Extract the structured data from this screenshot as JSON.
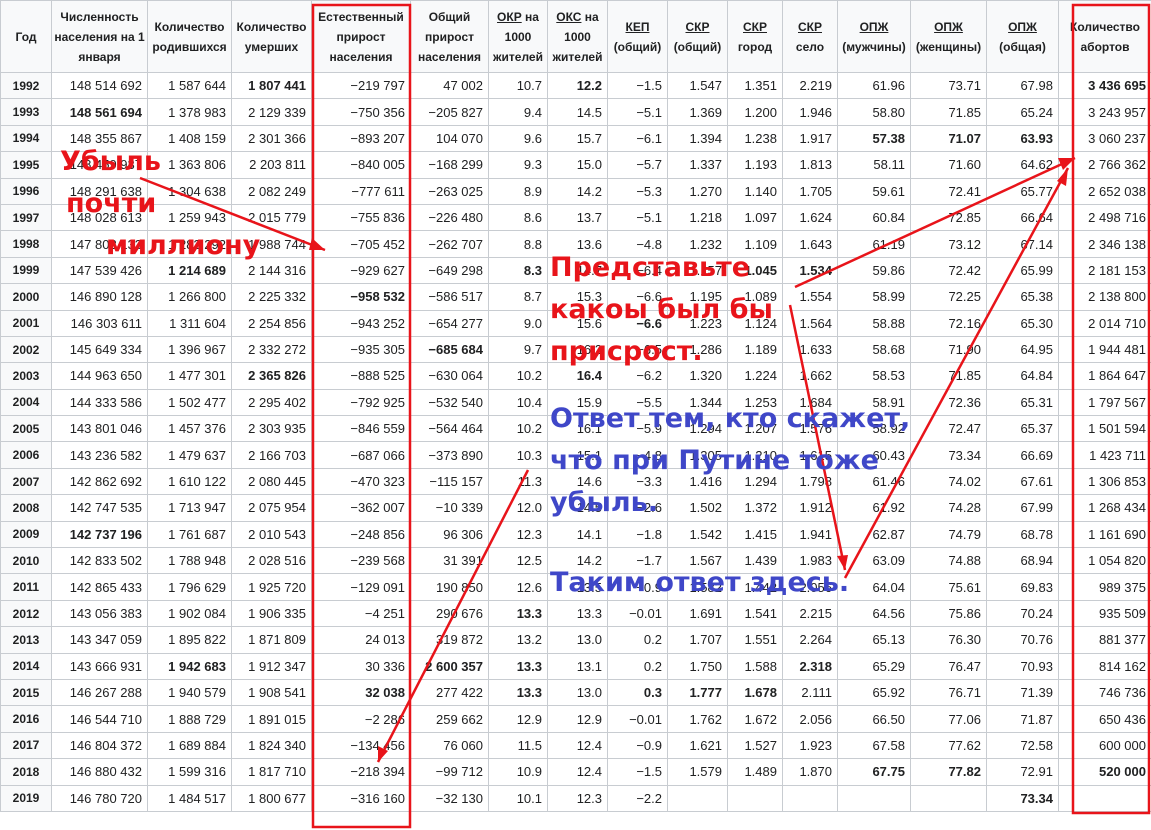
{
  "headers": [
    {
      "text": "Год"
    },
    {
      "text": "Численность населения на 1 января"
    },
    {
      "text": "Количество родившихся"
    },
    {
      "text": "Количество умерших"
    },
    {
      "text": "Естественный прирост населения"
    },
    {
      "text": "Общий прирост населения"
    },
    {
      "text": "ОКР на 1000 жителей",
      "ul": "ОКР"
    },
    {
      "text": "ОКС на 1000 жителей",
      "ul": "ОКС"
    },
    {
      "text": "КЕП (общий)",
      "ul": "КЕП"
    },
    {
      "text": "СКР (общий)",
      "ul": "СКР"
    },
    {
      "text": "СКР город",
      "ul": "СКР"
    },
    {
      "text": "СКР село",
      "ul": "СКР"
    },
    {
      "text": "ОПЖ (мужчины)",
      "ul": "ОПЖ"
    },
    {
      "text": "ОПЖ (женщины)",
      "ul": "ОПЖ"
    },
    {
      "text": "ОПЖ (общая)",
      "ul": "ОПЖ"
    },
    {
      "text": "Количество абортов"
    }
  ],
  "rows": [
    [
      "1992",
      "148 514 692",
      "1 587 644",
      "1 807 441",
      "−219 797",
      "47 002",
      "10.7",
      "12.2",
      "−1.5",
      "1.547",
      "1.351",
      "2.219",
      "61.96",
      "73.71",
      "67.98",
      "3 436 695"
    ],
    [
      "1993",
      "148 561 694",
      "1 378 983",
      "2 129 339",
      "−750 356",
      "−205 827",
      "9.4",
      "14.5",
      "−5.1",
      "1.369",
      "1.200",
      "1.946",
      "58.80",
      "71.85",
      "65.24",
      "3 243 957"
    ],
    [
      "1994",
      "148 355 867",
      "1 408 159",
      "2 301 366",
      "−893 207",
      "104 070",
      "9.6",
      "15.7",
      "−6.1",
      "1.394",
      "1.238",
      "1.917",
      "57.38",
      "71.07",
      "63.93",
      "3 060 237"
    ],
    [
      "1995",
      "148 459 937",
      "1 363 806",
      "2 203 811",
      "−840 005",
      "−168 299",
      "9.3",
      "15.0",
      "−5.7",
      "1.337",
      "1.193",
      "1.813",
      "58.11",
      "71.60",
      "64.62",
      "2 766 362"
    ],
    [
      "1996",
      "148 291 638",
      "1 304 638",
      "2 082 249",
      "−777 611",
      "−263 025",
      "8.9",
      "14.2",
      "−5.3",
      "1.270",
      "1.140",
      "1.705",
      "59.61",
      "72.41",
      "65.77",
      "2 652 038"
    ],
    [
      "1997",
      "148 028 613",
      "1 259 943",
      "2 015 779",
      "−755 836",
      "−226 480",
      "8.6",
      "13.7",
      "−5.1",
      "1.218",
      "1.097",
      "1.624",
      "60.84",
      "72.85",
      "66.64",
      "2 498 716"
    ],
    [
      "1998",
      "147 802 133",
      "1 283 292",
      "1 988 744",
      "−705 452",
      "−262 707",
      "8.8",
      "13.6",
      "−4.8",
      "1.232",
      "1.109",
      "1.643",
      "61.19",
      "73.12",
      "67.14",
      "2 346 138"
    ],
    [
      "1999",
      "147 539 426",
      "1 214 689",
      "2 144 316",
      "−929 627",
      "−649 298",
      "8.3",
      "14.7",
      "−6.4",
      "1.157",
      "1.045",
      "1.534",
      "59.86",
      "72.42",
      "65.99",
      "2 181 153"
    ],
    [
      "2000",
      "146 890 128",
      "1 266 800",
      "2 225 332",
      "−958 532",
      "−586 517",
      "8.7",
      "15.3",
      "−6.6",
      "1.195",
      "1.089",
      "1.554",
      "58.99",
      "72.25",
      "65.38",
      "2 138 800"
    ],
    [
      "2001",
      "146 303 611",
      "1 311 604",
      "2 254 856",
      "−943 252",
      "−654 277",
      "9.0",
      "15.6",
      "−6.6",
      "1.223",
      "1.124",
      "1.564",
      "58.88",
      "72.16",
      "65.30",
      "2 014 710"
    ],
    [
      "2002",
      "145 649 334",
      "1 396 967",
      "2 332 272",
      "−935 305",
      "−685 684",
      "9.7",
      "16.2",
      "−6.5",
      "1.286",
      "1.189",
      "1.633",
      "58.68",
      "71.90",
      "64.95",
      "1 944 481"
    ],
    [
      "2003",
      "144 963 650",
      "1 477 301",
      "2 365 826",
      "−888 525",
      "−630 064",
      "10.2",
      "16.4",
      "−6.2",
      "1.320",
      "1.224",
      "1.662",
      "58.53",
      "71.85",
      "64.84",
      "1 864 647"
    ],
    [
      "2004",
      "144 333 586",
      "1 502 477",
      "2 295 402",
      "−792 925",
      "−532 540",
      "10.4",
      "15.9",
      "−5.5",
      "1.344",
      "1.253",
      "1.684",
      "58.91",
      "72.36",
      "65.31",
      "1 797 567"
    ],
    [
      "2005",
      "143 801 046",
      "1 457 376",
      "2 303 935",
      "−846 559",
      "−564 464",
      "10.2",
      "16.1",
      "−5.9",
      "1.294",
      "1.207",
      "1.576",
      "58.92",
      "72.47",
      "65.37",
      "1 501 594"
    ],
    [
      "2006",
      "143 236 582",
      "1 479 637",
      "2 166 703",
      "−687 066",
      "−373 890",
      "10.3",
      "15.1",
      "−4.8",
      "1.305",
      "1.210",
      "1.615",
      "60.43",
      "73.34",
      "66.69",
      "1 423 711"
    ],
    [
      "2007",
      "142 862 692",
      "1 610 122",
      "2 080 445",
      "−470 323",
      "−115 157",
      "11.3",
      "14.6",
      "−3.3",
      "1.416",
      "1.294",
      "1.798",
      "61.46",
      "74.02",
      "67.61",
      "1 306 853"
    ],
    [
      "2008",
      "142 747 535",
      "1 713 947",
      "2 075 954",
      "−362 007",
      "−10 339",
      "12.0",
      "14.5",
      "−2.6",
      "1.502",
      "1.372",
      "1.912",
      "61.92",
      "74.28",
      "67.99",
      "1 268 434"
    ],
    [
      "2009",
      "142 737 196",
      "1 761 687",
      "2 010 543",
      "−248 856",
      "96 306",
      "12.3",
      "14.1",
      "−1.8",
      "1.542",
      "1.415",
      "1.941",
      "62.87",
      "74.79",
      "68.78",
      "1 161 690"
    ],
    [
      "2010",
      "142 833 502",
      "1 788 948",
      "2 028 516",
      "−239 568",
      "31 391",
      "12.5",
      "14.2",
      "−1.7",
      "1.567",
      "1.439",
      "1.983",
      "63.09",
      "74.88",
      "68.94",
      "1 054 820"
    ],
    [
      "2011",
      "142 865 433",
      "1 796 629",
      "1 925 720",
      "−129 091",
      "190 850",
      "12.6",
      "13.5",
      "−0.9",
      "1.582",
      "1.442",
      "2.056",
      "64.04",
      "75.61",
      "69.83",
      "989 375"
    ],
    [
      "2012",
      "143 056 383",
      "1 902 084",
      "1 906 335",
      "−4 251",
      "290 676",
      "13.3",
      "13.3",
      "−0.01",
      "1.691",
      "1.541",
      "2.215",
      "64.56",
      "75.86",
      "70.24",
      "935 509"
    ],
    [
      "2013",
      "143 347 059",
      "1 895 822",
      "1 871 809",
      "24 013",
      "319 872",
      "13.2",
      "13.0",
      "0.2",
      "1.707",
      "1.551",
      "2.264",
      "65.13",
      "76.30",
      "70.76",
      "881 377"
    ],
    [
      "2014",
      "143 666 931",
      "1 942 683",
      "1 912 347",
      "30 336",
      "2 600 357",
      "13.3",
      "13.1",
      "0.2",
      "1.750",
      "1.588",
      "2.318",
      "65.29",
      "76.47",
      "70.93",
      "814 162"
    ],
    [
      "2015",
      "146 267 288",
      "1 940 579",
      "1 908 541",
      "32 038",
      "277 422",
      "13.3",
      "13.0",
      "0.3",
      "1.777",
      "1.678",
      "2.111",
      "65.92",
      "76.71",
      "71.39",
      "746 736"
    ],
    [
      "2016",
      "146 544 710",
      "1 888 729",
      "1 891 015",
      "−2 286",
      "259 662",
      "12.9",
      "12.9",
      "−0.01",
      "1.762",
      "1.672",
      "2.056",
      "66.50",
      "77.06",
      "71.87",
      "650 436"
    ],
    [
      "2017",
      "146 804 372",
      "1 689 884",
      "1 824 340",
      "−134 456",
      "76 060",
      "11.5",
      "12.4",
      "−0.9",
      "1.621",
      "1.527",
      "1.923",
      "67.58",
      "77.62",
      "72.58",
      "600 000"
    ],
    [
      "2018",
      "146 880 432",
      "1 599 316",
      "1 817 710",
      "−218 394",
      "−99 712",
      "10.9",
      "12.4",
      "−1.5",
      "1.579",
      "1.489",
      "1.870",
      "67.75",
      "77.82",
      "72.91",
      "520 000"
    ],
    [
      "2019",
      "146 780 720",
      "1 484 517",
      "1 800 677",
      "−316 160",
      "−32 130",
      "10.1",
      "12.3",
      "−2.2",
      "",
      "",
      "",
      "",
      "",
      "73.34",
      ""
    ]
  ],
  "highlights": {
    "1992": {
      "3": "grn",
      "7": "grn",
      "15": "red"
    },
    "1993": {
      "1": "grn"
    },
    "1994": {
      "12": "red",
      "13": "red",
      "14": "red"
    },
    "1999": {
      "2": "red",
      "6": "red",
      "10": "red",
      "11": "red"
    },
    "2000": {
      "4": "red"
    },
    "2001": {
      "8": "red"
    },
    "2002": {
      "5": "red"
    },
    "2003": {
      "3": "red",
      "7": "red"
    },
    "2009": {
      "1": "red"
    },
    "2012": {
      "6": "grn"
    },
    "2014": {
      "2": "grn",
      "5": "grn",
      "6": "grn",
      "11": "grn"
    },
    "2015": {
      "4": "grn",
      "6": "grn",
      "8": "grn",
      "9": "grn",
      "10": "grn"
    },
    "2018": {
      "12": "grn",
      "13": "grn",
      "15": "grn"
    },
    "2019": {
      "14": "grn"
    }
  },
  "colors": {
    "negative": "#d33",
    "positive": "#14866d",
    "annotation_red": "#e8141a",
    "annotation_blue": "#3f47c8"
  },
  "annotations": {
    "loss_line1": "Убыль",
    "loss_line2": "почти",
    "loss_line3": "миллиону",
    "imagine_line1": "Представьте",
    "imagine_line2": "какоы был бы",
    "imagine_line3": "присрост.",
    "answer_line1": "Ответ тем, кто скажет,",
    "answer_line2": "что при Путине тоже",
    "answer_line3": "убыль.",
    "answer_line4": "Таким ответ здесь."
  }
}
